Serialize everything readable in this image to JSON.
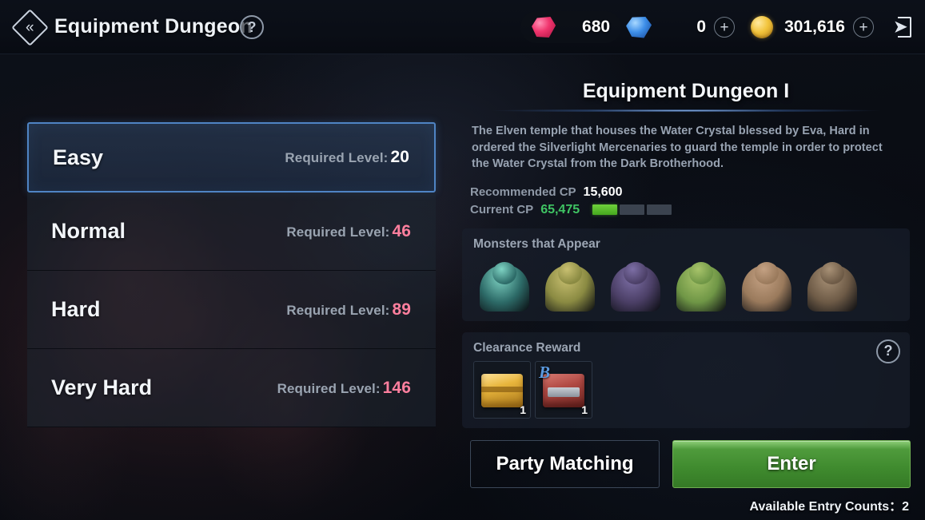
{
  "header": {
    "back_icon": "chevron-left-double-icon",
    "title": "Equipment Dungeon",
    "help_icon": "?",
    "currencies": [
      {
        "icon": "ruby-gem-icon",
        "value": "680",
        "has_plus": false
      },
      {
        "icon": "blue-diamond-icon",
        "value": "0",
        "has_plus": true,
        "plus": "+"
      },
      {
        "icon": "gold-coin-icon",
        "value": "301,616",
        "has_plus": true,
        "plus": "+"
      }
    ],
    "exit_icon": "exit-door-icon"
  },
  "difficulties": [
    {
      "name": "Easy",
      "req_label": "Required Level:",
      "level": "20",
      "selected": true,
      "locked": false
    },
    {
      "name": "Normal",
      "req_label": "Required Level:",
      "level": "46",
      "selected": false,
      "locked": true
    },
    {
      "name": "Hard",
      "req_label": "Required Level:",
      "level": "89",
      "selected": false,
      "locked": true
    },
    {
      "name": "Very Hard",
      "req_label": "Required Level:",
      "level": "146",
      "selected": false,
      "locked": true
    }
  ],
  "detail": {
    "title": "Equipment Dungeon I",
    "description": "The Elven temple that houses the Water Crystal blessed by Eva, Hard in ordered the Silverlight Mercenaries to guard the temple in order to protect the Water Crystal from the Dark Brotherhood.",
    "recommended_cp_label": "Recommended CP",
    "recommended_cp_value": "15,600",
    "current_cp_label": "Current CP",
    "current_cp_value": "65,475",
    "cp_bar": {
      "segments": 3,
      "filled": 1,
      "fill_color": "#4fae24"
    },
    "monsters_heading": "Monsters that Appear",
    "monsters": [
      {
        "name": "teal-serpent-monster",
        "body": "#2d6b68",
        "head": "#7fd4c4"
      },
      {
        "name": "yellow-beast-monster",
        "body": "#8a8a42",
        "head": "#c9c071"
      },
      {
        "name": "purple-mage-monster",
        "body": "#4b3f66",
        "head": "#7d6fa6"
      },
      {
        "name": "green-siren-monster",
        "body": "#6f9646",
        "head": "#a8c46a"
      },
      {
        "name": "twin-brute-monster",
        "body": "#9a7a5c",
        "head": "#c4a183"
      },
      {
        "name": "horned-ogre-monster",
        "body": "#6d5a46",
        "head": "#a89176"
      }
    ],
    "reward_heading": "Clearance Reward",
    "reward_help_icon": "?",
    "rewards": [
      {
        "name": "gold-chest-reward",
        "type": "gold",
        "grade": "",
        "qty": "1"
      },
      {
        "name": "red-chest-reward",
        "type": "red",
        "grade": "B",
        "qty": "1"
      }
    ]
  },
  "actions": {
    "party_matching_label": "Party Matching",
    "enter_label": "Enter",
    "entry_counts": "Available Entry Counts：2"
  }
}
